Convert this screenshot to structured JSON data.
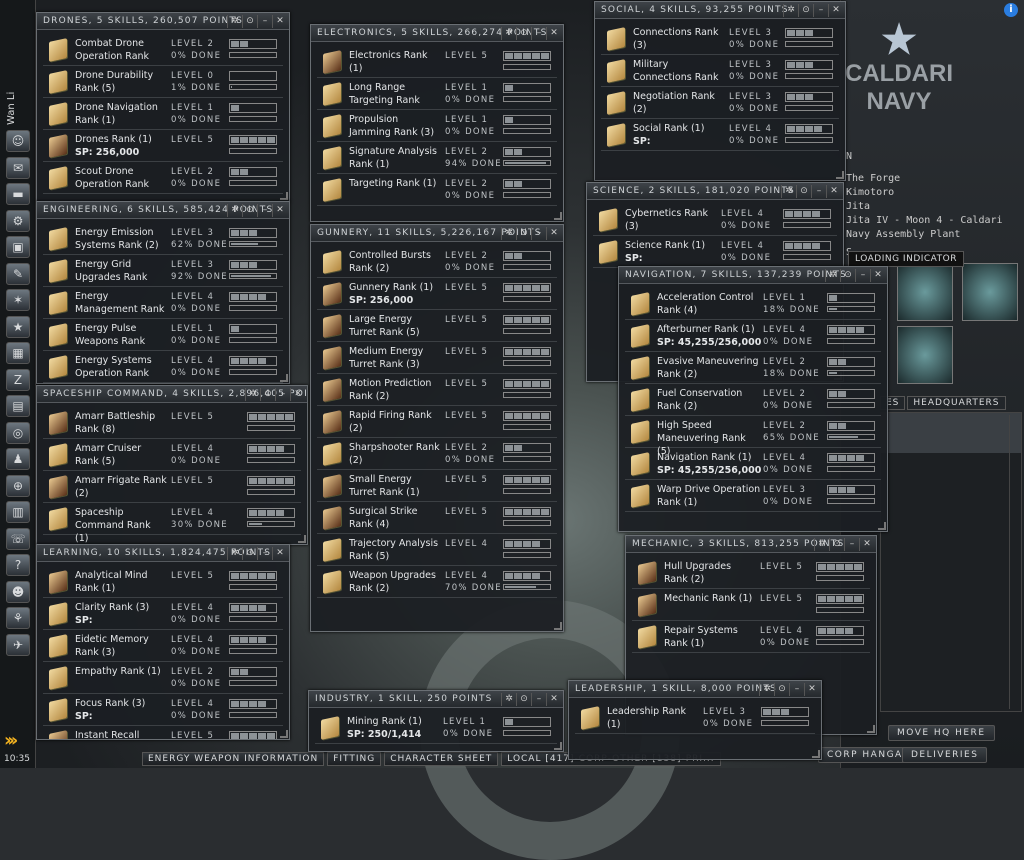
{
  "sidebar": {
    "character_name": "Wan Li",
    "clock": "10:35"
  },
  "taskbar": [
    "ENERGY WEAPON INFORMATION",
    "FITTING",
    "CHARACTER SHEET",
    "LOCAL [417]-CORP-OTHER [138]-PRI..."
  ],
  "station": {
    "logo_line1": "CALDARI",
    "logo_line2": "NAVY",
    "info": [
      "N",
      "The Forge",
      "Kimotoro",
      "Jita",
      "Jita IV - Moon 4 - Caldari",
      "Navy Assembly Plant",
      "S"
    ],
    "tooltip": "LOADING INDICATOR",
    "tabs": [
      "ES",
      "HEADQUARTERS"
    ],
    "buttons": {
      "move_hq": "MOVE HQ HERE",
      "corp_hangar": "CORP HANGAR",
      "deliveries": "DELIVERIES"
    }
  },
  "window_buttons": {
    "pin": "✲",
    "settings": "⊙",
    "minimize": "–",
    "close": "✕"
  },
  "windows": [
    {
      "id": "drones",
      "title": "DRONES, 5 SKILLS, 260,507 POINTS",
      "skills": [
        {
          "name": "Combat Drone Operation Rank",
          "level": 2,
          "done": 0,
          "level_text": "LEVEL 2",
          "done_text": "0% DONE"
        },
        {
          "name": "Drone Durability Rank (5)",
          "level": 0,
          "done": 1,
          "level_text": "LEVEL 0",
          "done_text": "1% DONE"
        },
        {
          "name": "Drone Navigation Rank (1)",
          "level": 1,
          "done": 0,
          "level_text": "LEVEL 1",
          "done_text": "0% DONE"
        },
        {
          "name": "Drones Rank (1)",
          "sp": "SP: 256,000",
          "level": 5,
          "done": 0,
          "level_text": "LEVEL 5",
          "done_text": ""
        },
        {
          "name": "Scout Drone Operation Rank",
          "level": 2,
          "done": 0,
          "level_text": "LEVEL 2",
          "done_text": "0% DONE"
        }
      ]
    },
    {
      "id": "engineering",
      "title": "ENGINEERING, 6 SKILLS, 585,424 POINTS",
      "skills": [
        {
          "name": "Energy Emission Systems Rank (2)",
          "level": 3,
          "done": 62,
          "level_text": "LEVEL 3",
          "done_text": "62% DONE"
        },
        {
          "name": "Energy Grid Upgrades Rank",
          "level": 3,
          "done": 92,
          "level_text": "LEVEL 3",
          "done_text": "92% DONE"
        },
        {
          "name": "Energy Management Rank",
          "level": 4,
          "done": 0,
          "level_text": "LEVEL 4",
          "done_text": "0% DONE"
        },
        {
          "name": "Energy Pulse Weapons Rank",
          "level": 1,
          "done": 0,
          "level_text": "LEVEL 1",
          "done_text": "0% DONE"
        },
        {
          "name": "Energy Systems Operation Rank",
          "level": 4,
          "done": 0,
          "level_text": "LEVEL 4",
          "done_text": "0% DONE"
        }
      ]
    },
    {
      "id": "spaceship",
      "title": "SPACESHIP COMMAND, 4 SKILLS, 2,896,405 POINTS",
      "skills": [
        {
          "name": "Amarr Battleship Rank (8)",
          "level": 5,
          "done": 0,
          "level_text": "LEVEL 5",
          "done_text": ""
        },
        {
          "name": "Amarr Cruiser Rank (5)",
          "level": 4,
          "done": 0,
          "level_text": "LEVEL 4",
          "done_text": "0% DONE"
        },
        {
          "name": "Amarr Frigate Rank (2)",
          "level": 5,
          "done": 0,
          "level_text": "LEVEL 5",
          "done_text": ""
        },
        {
          "name": "Spaceship Command Rank (1)",
          "level": 4,
          "done": 30,
          "level_text": "LEVEL 4",
          "done_text": "30% DONE"
        }
      ]
    },
    {
      "id": "learning",
      "title": "LEARNING, 10 SKILLS, 1,824,475 POINTS",
      "skills": [
        {
          "name": "Analytical Mind Rank (1)",
          "level": 5,
          "done": 0,
          "level_text": "LEVEL 5",
          "done_text": ""
        },
        {
          "name": "Clarity Rank (3)",
          "sp": "SP:",
          "level": 4,
          "done": 0,
          "level_text": "LEVEL 4",
          "done_text": "0% DONE"
        },
        {
          "name": "Eidetic Memory Rank (3)",
          "level": 4,
          "done": 0,
          "level_text": "LEVEL 4",
          "done_text": "0% DONE"
        },
        {
          "name": "Empathy Rank (1)",
          "level": 2,
          "done": 0,
          "level_text": "LEVEL 2",
          "done_text": "0% DONE"
        },
        {
          "name": "Focus Rank (3)",
          "sp": "SP:",
          "level": 4,
          "done": 0,
          "level_text": "LEVEL 4",
          "done_text": "0% DONE"
        },
        {
          "name": "Instant Recall",
          "level": 5,
          "done": 0,
          "level_text": "LEVEL 5",
          "done_text": ""
        }
      ]
    },
    {
      "id": "electronics",
      "title": "ELECTRONICS, 5 SKILLS, 266,274 POINTS",
      "skills": [
        {
          "name": "Electronics Rank (1)",
          "level": 5,
          "done": 0,
          "level_text": "LEVEL 5",
          "done_text": ""
        },
        {
          "name": "Long Range Targeting Rank",
          "level": 1,
          "done": 0,
          "level_text": "LEVEL 1",
          "done_text": "0% DONE"
        },
        {
          "name": "Propulsion Jamming Rank (3)",
          "level": 1,
          "done": 0,
          "level_text": "LEVEL 1",
          "done_text": "0% DONE"
        },
        {
          "name": "Signature Analysis Rank (1)",
          "level": 2,
          "done": 94,
          "level_text": "LEVEL 2",
          "done_text": "94% DONE"
        },
        {
          "name": "Targeting Rank (1)",
          "level": 2,
          "done": 0,
          "level_text": "LEVEL 2",
          "done_text": "0% DONE"
        }
      ]
    },
    {
      "id": "gunnery",
      "title": "GUNNERY, 11 SKILLS, 5,226,167 POINTS",
      "skills": [
        {
          "name": "Controlled Bursts Rank (2)",
          "level": 2,
          "done": 0,
          "level_text": "LEVEL 2",
          "done_text": "0% DONE"
        },
        {
          "name": "Gunnery Rank (1)",
          "sp": "SP: 256,000",
          "level": 5,
          "done": 0,
          "level_text": "LEVEL 5",
          "done_text": ""
        },
        {
          "name": "Large Energy Turret Rank (5)",
          "level": 5,
          "done": 0,
          "level_text": "LEVEL 5",
          "done_text": ""
        },
        {
          "name": "Medium Energy Turret Rank (3)",
          "level": 5,
          "done": 0,
          "level_text": "LEVEL 5",
          "done_text": ""
        },
        {
          "name": "Motion Prediction Rank (2)",
          "level": 5,
          "done": 0,
          "level_text": "LEVEL 5",
          "done_text": ""
        },
        {
          "name": "Rapid Firing Rank (2)",
          "level": 5,
          "done": 0,
          "level_text": "LEVEL 5",
          "done_text": ""
        },
        {
          "name": "Sharpshooter Rank (2)",
          "level": 2,
          "done": 0,
          "level_text": "LEVEL 2",
          "done_text": "0% DONE"
        },
        {
          "name": "Small Energy Turret Rank (1)",
          "level": 5,
          "done": 0,
          "level_text": "LEVEL 5",
          "done_text": ""
        },
        {
          "name": "Surgical Strike Rank (4)",
          "level": 5,
          "done": 0,
          "level_text": "LEVEL 5",
          "done_text": ""
        },
        {
          "name": "Trajectory Analysis Rank (5)",
          "level": 4,
          "done": 0,
          "level_text": "LEVEL 4",
          "done_text": ""
        },
        {
          "name": "Weapon Upgrades Rank (2)",
          "level": 4,
          "done": 70,
          "level_text": "LEVEL 4",
          "done_text": "70% DONE"
        }
      ]
    },
    {
      "id": "social",
      "title": "SOCIAL, 4 SKILLS, 93,255 POINTS",
      "skills": [
        {
          "name": "Connections Rank (3)",
          "level": 3,
          "done": 0,
          "level_text": "LEVEL 3",
          "done_text": "0% DONE"
        },
        {
          "name": "Military Connections Rank",
          "level": 3,
          "done": 0,
          "level_text": "LEVEL 3",
          "done_text": "0% DONE"
        },
        {
          "name": "Negotiation Rank (2)",
          "level": 3,
          "done": 0,
          "level_text": "LEVEL 3",
          "done_text": "0% DONE"
        },
        {
          "name": "Social Rank (1)",
          "sp": "SP:",
          "level": 4,
          "done": 0,
          "level_text": "LEVEL 4",
          "done_text": "0% DONE"
        }
      ]
    },
    {
      "id": "science",
      "title": "SCIENCE, 2 SKILLS, 181,020 POINTS",
      "skills": [
        {
          "name": "Cybernetics Rank (3)",
          "level": 4,
          "done": 0,
          "level_text": "LEVEL 4",
          "done_text": "0% DONE"
        },
        {
          "name": "Science Rank (1)",
          "sp": "SP:",
          "level": 4,
          "done": 0,
          "level_text": "LEVEL 4",
          "done_text": "0% DONE"
        }
      ]
    },
    {
      "id": "navigation",
      "title": "NAVIGATION, 7 SKILLS, 137,239 POINTS",
      "skills": [
        {
          "name": "Acceleration Control Rank (4)",
          "level": 1,
          "done": 18,
          "level_text": "LEVEL 1",
          "done_text": "18% DONE"
        },
        {
          "name": "Afterburner Rank (1)",
          "sp": "SP: 45,255/256,000",
          "level": 4,
          "done": 0,
          "level_text": "LEVEL 4",
          "done_text": "0% DONE"
        },
        {
          "name": "Evasive Maneuvering Rank (2)",
          "level": 2,
          "done": 18,
          "level_text": "LEVEL 2",
          "done_text": "18% DONE"
        },
        {
          "name": "Fuel Conservation Rank (2)",
          "level": 2,
          "done": 0,
          "level_text": "LEVEL 2",
          "done_text": "0% DONE"
        },
        {
          "name": "High Speed Maneuvering Rank (5)",
          "level": 2,
          "done": 65,
          "level_text": "LEVEL 2",
          "done_text": "65% DONE"
        },
        {
          "name": "Navigation Rank (1)",
          "sp": "SP: 45,255/256,000",
          "level": 4,
          "done": 0,
          "level_text": "LEVEL 4",
          "done_text": "0% DONE"
        },
        {
          "name": "Warp Drive Operation Rank (1)",
          "level": 3,
          "done": 0,
          "level_text": "LEVEL 3",
          "done_text": "0% DONE"
        }
      ]
    },
    {
      "id": "mechanic",
      "title": "MECHANIC, 3 SKILLS, 813,255 POINTS",
      "skills": [
        {
          "name": "Hull Upgrades Rank (2)",
          "level": 5,
          "done": 0,
          "level_text": "LEVEL 5",
          "done_text": ""
        },
        {
          "name": "Mechanic Rank (1)",
          "level": 5,
          "done": 0,
          "level_text": "LEVEL 5",
          "done_text": ""
        },
        {
          "name": "Repair Systems Rank (1)",
          "level": 4,
          "done": 0,
          "level_text": "LEVEL 4",
          "done_text": "0% DONE"
        }
      ]
    },
    {
      "id": "industry",
      "title": "INDUSTRY, 1 SKILL, 250 POINTS",
      "skills": [
        {
          "name": "Mining Rank (1)",
          "sp": "SP: 250/1,414",
          "level": 1,
          "done": 0,
          "level_text": "LEVEL 1",
          "done_text": "0% DONE"
        }
      ]
    },
    {
      "id": "leadership",
      "title": "LEADERSHIP, 1 SKILL, 8,000 POINTS",
      "skills": [
        {
          "name": "Leadership Rank (1)",
          "level": 3,
          "done": 0,
          "level_text": "LEVEL 3",
          "done_text": "0% DONE"
        }
      ]
    }
  ]
}
